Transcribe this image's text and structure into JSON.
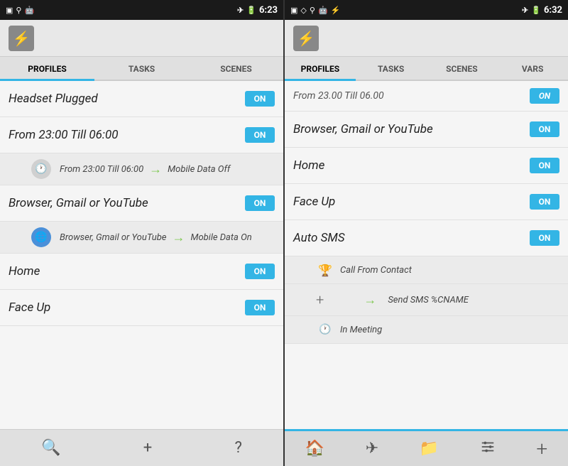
{
  "left_panel": {
    "status_bar": {
      "time": "6:23",
      "icons_left": [
        "sim",
        "usb",
        "android"
      ],
      "icons_right": [
        "airplane",
        "battery",
        "time"
      ]
    },
    "app_icon": "⚙",
    "tabs": [
      {
        "label": "PROFILES",
        "active": true
      },
      {
        "label": "TASKS",
        "active": false
      },
      {
        "label": "SCENES",
        "active": false
      }
    ],
    "profiles": [
      {
        "name": "Headset Plugged",
        "toggle": "ON"
      },
      {
        "name": "From 23:00 Till 06:00",
        "toggle": "ON"
      },
      {
        "name": "Browser, Gmail or YouTube",
        "toggle": "ON"
      },
      {
        "name": "Home",
        "toggle": "ON"
      },
      {
        "name": "Face Up",
        "toggle": "ON"
      }
    ],
    "tasks": [
      {
        "profile": "From 23:00 Till 06:00",
        "icon_type": "clock",
        "name": "From 23:00 Till 06:00",
        "action": "Mobile Data Off"
      },
      {
        "profile": "Browser, Gmail or YouTube",
        "icon_type": "globe",
        "name": "Browser, Gmail or YouTube",
        "action": "Mobile Data On"
      }
    ],
    "bottom_buttons": [
      "🔍",
      "+",
      "?"
    ]
  },
  "right_panel": {
    "status_bar": {
      "time": "6:32",
      "icons_left": [
        "sim",
        "diamond",
        "usb",
        "android",
        "bolt"
      ],
      "icons_right": [
        "airplane",
        "battery",
        "time"
      ]
    },
    "app_icon": "⚙",
    "tabs": [
      {
        "label": "PROFILES",
        "active": true
      },
      {
        "label": "TASKS",
        "active": false
      },
      {
        "label": "SCENES",
        "active": false
      },
      {
        "label": "VARS",
        "active": false
      }
    ],
    "scroll_top_item": "From 23.00 Till 06.00",
    "profiles": [
      {
        "name": "Browser, Gmail or YouTube",
        "toggle": "ON"
      },
      {
        "name": "Home",
        "toggle": "ON"
      },
      {
        "name": "Face Up",
        "toggle": "ON"
      },
      {
        "name": "Auto SMS",
        "toggle": "ON"
      }
    ],
    "auto_sms_conditions": [
      {
        "icon_type": "trophy",
        "name": "Call From Contact"
      },
      {
        "type": "plus"
      },
      {
        "icon_type": "clock-off",
        "name": "In Meeting"
      }
    ],
    "auto_sms_action": "Send SMS %CNAME",
    "bottom_nav": [
      {
        "icon": "🏠",
        "label": "home",
        "active": true
      },
      {
        "icon": "✈",
        "label": "airplane"
      },
      {
        "icon": "📁",
        "label": "folder"
      },
      {
        "icon": "⚙",
        "label": "settings"
      },
      {
        "icon": "+",
        "label": "add"
      }
    ]
  }
}
